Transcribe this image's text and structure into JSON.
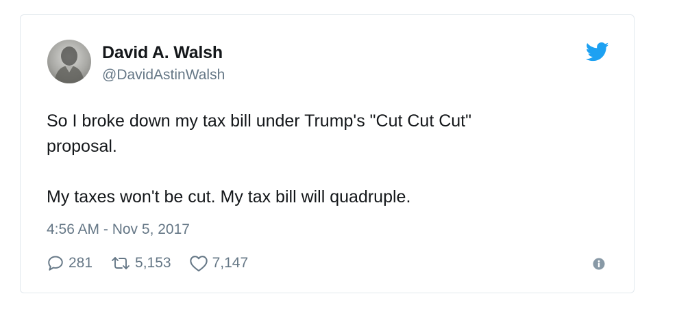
{
  "tweet": {
    "author_name": "David A. Walsh",
    "author_handle": "@DavidAstinWalsh",
    "text_lines": [
      "So I broke down my tax bill under Trump's \"Cut Cut Cut\"",
      "proposal.",
      "My taxes won't be cut. My tax bill will quadruple."
    ],
    "timestamp": "4:56 AM - Nov 5, 2017",
    "replies": "281",
    "retweets": "5,153",
    "likes": "7,147"
  },
  "icons": {
    "brand": "twitter-bird-icon",
    "reply": "reply-icon",
    "retweet": "retweet-icon",
    "like": "heart-icon",
    "info": "info-icon"
  },
  "colors": {
    "brand_blue": "#1da1f2",
    "text": "#14171a",
    "secondary": "#657786",
    "border": "#e1e8ed"
  }
}
